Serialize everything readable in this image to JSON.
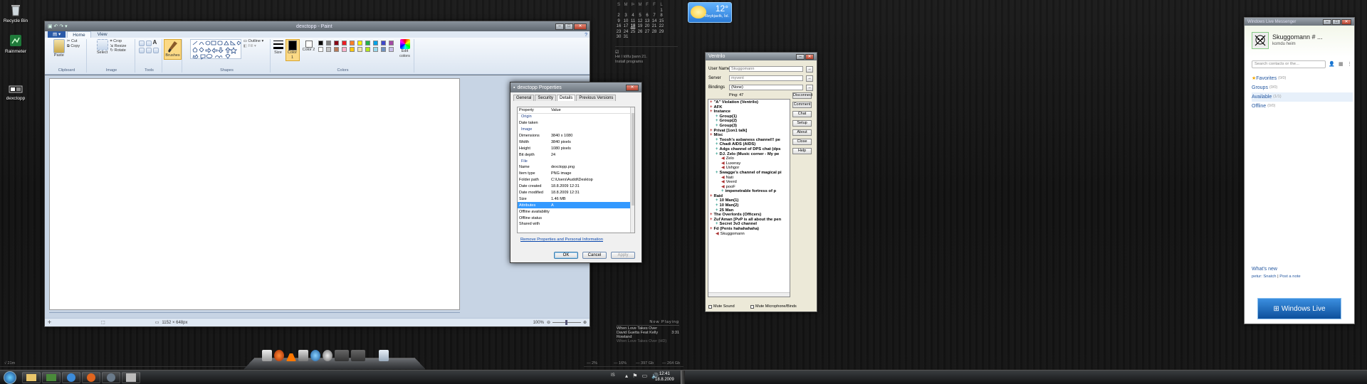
{
  "desktop": {
    "icons": [
      {
        "label": "Recycle Bin",
        "icon": "recycle-bin-icon"
      },
      {
        "label": "Rainmeter",
        "icon": "rainmeter-icon"
      },
      {
        "label": "dexctopp",
        "icon": "image-file-icon"
      }
    ]
  },
  "paint": {
    "title": "dexctopp - Paint",
    "tabs": [
      "Home",
      "View"
    ],
    "groups": {
      "clipboard": "Clipboard",
      "image": "Image",
      "tools": "Tools",
      "shapes": "Shapes",
      "colors": "Colors"
    },
    "clipboard": {
      "paste": "Paste",
      "cut": "Cut",
      "copy": "Copy"
    },
    "image": {
      "select": "Select",
      "crop": "Crop",
      "resize": "Resize",
      "rotate": "Rotate"
    },
    "brushes": "Brushes",
    "outline": "Outline",
    "fill": "Fill",
    "size": "Size",
    "color1": "Color 1",
    "color2": "Color 2",
    "edit_colors": "Edit colors",
    "palette": [
      "#000000",
      "#7f7f7f",
      "#880015",
      "#ed1c24",
      "#ff7f27",
      "#fff200",
      "#22b14c",
      "#00a2e8",
      "#3f48cc",
      "#a349a4",
      "#ffffff",
      "#c3c3c3",
      "#b97a57",
      "#ffaec9",
      "#ffc90e",
      "#efe4b0",
      "#b5e61d",
      "#99d9ea",
      "#7092be",
      "#c8bfe7"
    ],
    "status_size": "1152 × 648px",
    "zoom": "100%"
  },
  "properties": {
    "title": "dexctopp Properties",
    "tabs": [
      "General",
      "Security",
      "Details",
      "Previous Versions"
    ],
    "active_tab": "Details",
    "col_property": "Property",
    "col_value": "Value",
    "rows": [
      {
        "k": "Origin",
        "v": "",
        "section": true
      },
      {
        "k": "Date taken",
        "v": ""
      },
      {
        "k": "Image",
        "v": "",
        "section": true
      },
      {
        "k": "Dimensions",
        "v": "3840 x 1080"
      },
      {
        "k": "Width",
        "v": "3840 pixels"
      },
      {
        "k": "Height",
        "v": "1080 pixels"
      },
      {
        "k": "Bit depth",
        "v": "24"
      },
      {
        "k": "File",
        "v": "",
        "section": true
      },
      {
        "k": "Name",
        "v": "dexctopp.png"
      },
      {
        "k": "Item type",
        "v": "PNG image"
      },
      {
        "k": "Folder path",
        "v": "C:\\Users\\Auddi\\Desktop"
      },
      {
        "k": "Date created",
        "v": "18.8.2009 12:31"
      },
      {
        "k": "Date modified",
        "v": "18.8.2009 12:31"
      },
      {
        "k": "Size",
        "v": "1.46 MB"
      },
      {
        "k": "Attributes",
        "v": "A",
        "selected": true
      },
      {
        "k": "Offline availability",
        "v": ""
      },
      {
        "k": "Offline status",
        "v": ""
      },
      {
        "k": "Shared with",
        "v": ""
      }
    ],
    "link": "Remove Properties and Personal Information",
    "ok": "OK",
    "cancel": "Cancel",
    "apply": "Apply"
  },
  "calendar": {
    "headers": [
      "S",
      "M",
      "Þ",
      "M",
      "F",
      "F",
      "L"
    ],
    "weeks": [
      [
        "",
        "",
        "",
        "",
        "",
        "",
        "1"
      ],
      [
        "2",
        "3",
        "4",
        "5",
        "6",
        "7",
        "8"
      ],
      [
        "9",
        "10",
        "11",
        "12",
        "13",
        "14",
        "15"
      ],
      [
        "16",
        "17",
        "18",
        "19",
        "20",
        "21",
        "22"
      ],
      [
        "23",
        "24",
        "25",
        "26",
        "27",
        "28",
        "29"
      ],
      [
        "30",
        "31",
        "",
        "",
        "",
        "",
        ""
      ]
    ],
    "today": "18",
    "notes": [
      "Hé í tölfu þann 21.",
      "Install programs"
    ]
  },
  "weather": {
    "temp": "12°",
    "city": "Reykjavík, Ísl."
  },
  "now_playing": {
    "heading": "Now Playing",
    "track": "When Love Takes Over",
    "artist": "David Guetta Feat Kelly Rowland",
    "time": "3:31",
    "line3": "When Love Takes Over (HD)"
  },
  "ventrilo": {
    "title": "Ventrilo",
    "user_label": "User Name",
    "user_value": "Skuggomann",
    "server_label": "Server",
    "server_value": "myvent",
    "bindings_label": "Bindings",
    "bindings_value": "(None)",
    "ping": "Ping: 47",
    "buttons": [
      "Disconnect",
      "Comment",
      "Chat",
      "Setup",
      "About",
      "Close",
      "Help"
    ],
    "tree": [
      {
        "t": "\"A\" Violation (Ventrilo)",
        "lvl": 0
      },
      {
        "t": "AFK",
        "lvl": 0
      },
      {
        "t": "Instance",
        "lvl": 0
      },
      {
        "t": "Group(1)",
        "lvl": 1
      },
      {
        "t": "Group(2)",
        "lvl": 1
      },
      {
        "t": "Group(3)",
        "lvl": 1
      },
      {
        "t": "Privat [1on1 talk]",
        "lvl": 0
      },
      {
        "t": "Misc",
        "lvl": 0
      },
      {
        "t": "Toosh's asbaness channel!! pe",
        "lvl": 1
      },
      {
        "t": "Chadi AIDS (AIDS)",
        "lvl": 1
      },
      {
        "t": "Adgs channel of DPS chat (dps",
        "lvl": 1
      },
      {
        "t": "DJ. Zelo (Music corner - My pe",
        "lvl": 1
      },
      {
        "t": "Zelo",
        "lvl": 2,
        "user": true
      },
      {
        "t": "Luxeray",
        "lvl": 2,
        "user": true
      },
      {
        "t": "Ushgor",
        "lvl": 2,
        "user": true
      },
      {
        "t": "Swagge's channel of magical pi",
        "lvl": 1
      },
      {
        "t": "Nati",
        "lvl": 2,
        "user": true
      },
      {
        "t": "Veerd",
        "lvl": 2,
        "user": true
      },
      {
        "t": "pooF",
        "lvl": 2,
        "user": true
      },
      {
        "t": "impenetrable fortress of p",
        "lvl": 2
      },
      {
        "t": "Raid",
        "lvl": 0
      },
      {
        "t": "10 Man(1)",
        "lvl": 1
      },
      {
        "t": "10 Man(2)",
        "lvl": 1
      },
      {
        "t": "25 Man",
        "lvl": 1
      },
      {
        "t": "The Overlords (Officers)",
        "lvl": 0
      },
      {
        "t": "Zul'Aman [PvP is all about the pen",
        "lvl": 0
      },
      {
        "t": "Secret 3v3 channel",
        "lvl": 1
      },
      {
        "t": "Fd (Penis hahahahaha)",
        "lvl": 0
      },
      {
        "t": "Skuggomann",
        "lvl": 1,
        "user": true
      }
    ],
    "mute_sound": "Mute Sound",
    "mute_mic": "Mute Microphone/Binds"
  },
  "messenger": {
    "title": "Windows Live Messenger",
    "name": "Skuggomann # ...",
    "status_msg": "komdu heim",
    "search_placeholder": "Search contacts or the...",
    "groups": [
      {
        "label": "Favorites",
        "count": "(0/0)"
      },
      {
        "label": "Groups",
        "count": "(0/0)"
      },
      {
        "label": "Available",
        "count": "(1/1)"
      },
      {
        "label": "Offline",
        "count": "(0/0)"
      }
    ],
    "whats_new": "What's new",
    "news": "petur: Snatch",
    "post_note": "Post a note",
    "brand": "Windows Live"
  },
  "meters": {
    "left": "√ 21m",
    "cpu": "— 2%",
    "ram": "— 16%",
    "disk1": "— 397 Gb",
    "disk2": "— 264 Gb"
  },
  "clock": {
    "time": "12:41",
    "date": "18.8.2009",
    "lang": "IS"
  }
}
